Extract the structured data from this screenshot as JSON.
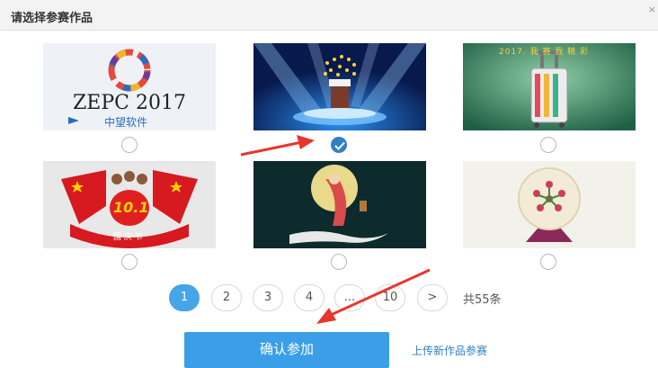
{
  "header": {
    "title": "请选择参赛作品",
    "close": "×"
  },
  "works": [
    {
      "id": "work-1",
      "caption_main": "ZEPC 2017",
      "caption_sub": "中望软件",
      "selected": false
    },
    {
      "id": "work-2",
      "selected": true
    },
    {
      "id": "work-3",
      "banner": "2017. 我 赛 我 精 彩",
      "selected": false
    },
    {
      "id": "work-4",
      "badge": "10.1",
      "banner": "国 庆 节",
      "selected": false
    },
    {
      "id": "work-5",
      "selected": false
    },
    {
      "id": "work-6",
      "selected": false
    }
  ],
  "pagination": {
    "pages": [
      "1",
      "2",
      "3",
      "4",
      "...",
      "10"
    ],
    "next": ">",
    "current": "1",
    "total": "共55条"
  },
  "actions": {
    "confirm": "确认参加",
    "upload": "上传新作品参赛"
  },
  "colors": {
    "accent": "#3a9fe6",
    "arrow": "#e6372f"
  }
}
